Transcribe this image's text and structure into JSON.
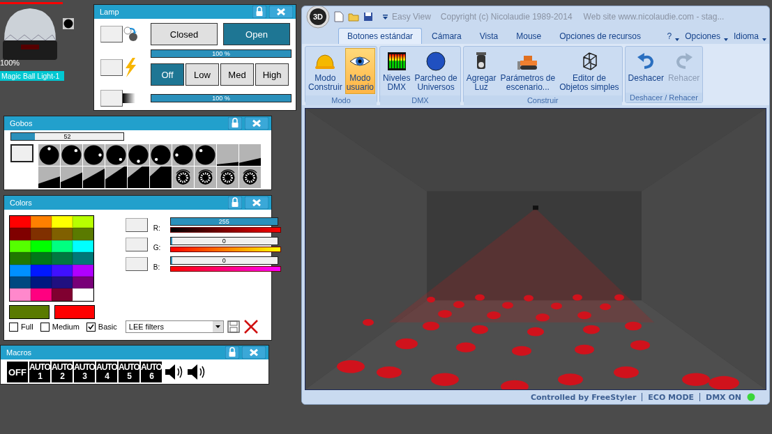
{
  "fixture": {
    "name": "Magic Ball Light-1",
    "intensity": "100%"
  },
  "lamp": {
    "title": "Lamp",
    "shutter": [
      {
        "label": "Closed",
        "selected": false
      },
      {
        "label": "Open",
        "selected": true
      }
    ],
    "dimmer": {
      "level": 1,
      "reading": "100 %"
    },
    "strobe": [
      {
        "label": "Off",
        "selected": true
      },
      {
        "label": "Low",
        "selected": false
      },
      {
        "label": "Med",
        "selected": false
      },
      {
        "label": "High",
        "selected": false
      }
    ],
    "fade": {
      "level": 1,
      "reading": "100 %"
    }
  },
  "gobos": {
    "title": "Gobos",
    "slider": {
      "level": 0.21,
      "reading": "52"
    }
  },
  "colors": {
    "title": "Colors",
    "palette": [
      {
        "color": "#ff0000"
      },
      {
        "color": "#ff8000"
      },
      {
        "color": "#ffff00"
      },
      {
        "color": "#b8ff00"
      },
      {
        "color": "#800000"
      },
      {
        "color": "#803000"
      },
      {
        "color": "#806000"
      },
      {
        "color": "#5a7a00"
      },
      {
        "color": "#55ff00"
      },
      {
        "color": "#00ff00"
      },
      {
        "color": "#00ff80"
      },
      {
        "color": "#00ffff"
      },
      {
        "color": "#207800"
      },
      {
        "color": "#007818"
      },
      {
        "color": "#007840"
      },
      {
        "color": "#007878"
      },
      {
        "color": "#0090ff"
      },
      {
        "color": "#0018ff"
      },
      {
        "color": "#4010ff"
      },
      {
        "color": "#b000ff"
      },
      {
        "color": "#004880"
      },
      {
        "color": "#001880"
      },
      {
        "color": "#201080"
      },
      {
        "color": "#780078"
      },
      {
        "color": "#ff88cc"
      },
      {
        "color": "#ff0080"
      },
      {
        "color": "#800030"
      },
      {
        "color": "#ffffff"
      }
    ],
    "swatches": [
      {
        "color": "#5a7a00"
      },
      {
        "color": "#ff0000"
      }
    ],
    "modes": [
      {
        "label": "Full",
        "checked": false
      },
      {
        "label": "Medium",
        "checked": false
      },
      {
        "label": "Basic",
        "checked": true
      }
    ],
    "channels": [
      {
        "label": "R:",
        "reading": "255",
        "level": 1
      },
      {
        "label": "G:",
        "reading": "0",
        "level": 0
      },
      {
        "label": "B:",
        "reading": "0",
        "level": 0
      }
    ],
    "filter": {
      "value": "LEE filters"
    }
  },
  "macros": {
    "title": "Macros",
    "buttons": [
      {
        "label": "OFF"
      },
      {
        "label": "AUTO",
        "number": "1"
      },
      {
        "label": "AUTO",
        "number": "2"
      },
      {
        "label": "AUTO",
        "number": "3"
      },
      {
        "label": "AUTO",
        "number": "4"
      },
      {
        "label": "AUTO",
        "number": "5"
      },
      {
        "label": "AUTO",
        "number": "6"
      }
    ]
  },
  "app": {
    "logo": "3D",
    "quick_access": "Easy View",
    "title": "Copyright (c) Nicolaudie 1989-2014",
    "website": "Web site www.nicolaudie.com - stag...",
    "tabs": [
      {
        "label": "Botones estándar",
        "selected": true
      },
      {
        "label": "Cámara",
        "selected": false
      },
      {
        "label": "Vista",
        "selected": false
      },
      {
        "label": "Mouse",
        "selected": false
      },
      {
        "label": "Opciones de recursos",
        "selected": false
      }
    ],
    "menus": [
      "?",
      "Opciones",
      "Idioma"
    ],
    "groups": [
      {
        "label": "Modo",
        "buttons": [
          {
            "label": "Modo\nConstruir",
            "kind": "hardhat",
            "selected": false,
            "disabled": false
          },
          {
            "label": "Modo\nusuario",
            "kind": "eye",
            "selected": true,
            "disabled": false
          }
        ]
      },
      {
        "label": "DMX",
        "buttons": [
          {
            "label": "Niveles\nDMX",
            "kind": "meter",
            "disabled": false
          },
          {
            "label": "Parcheo de\nUniversos",
            "kind": "globe",
            "disabled": false
          }
        ]
      },
      {
        "label": "Construir",
        "buttons": [
          {
            "label": "Agregar\nLuz",
            "kind": "spotlight",
            "disabled": false
          },
          {
            "label": "Parámetros de\nescenario...",
            "kind": "bulldozer",
            "disabled": false
          },
          {
            "label": "Editor de\nObjetos simples",
            "kind": "cube",
            "disabled": false
          }
        ]
      },
      {
        "label": "Deshacer / Rehacer",
        "buttons": [
          {
            "label": "Deshacer",
            "kind": "undo",
            "disabled": false
          },
          {
            "label": "Rehacer",
            "kind": "redo",
            "disabled": true
          }
        ]
      }
    ],
    "status": [
      "Controlled by FreeStyler",
      "ECO MODE",
      "DMX ON"
    ]
  }
}
